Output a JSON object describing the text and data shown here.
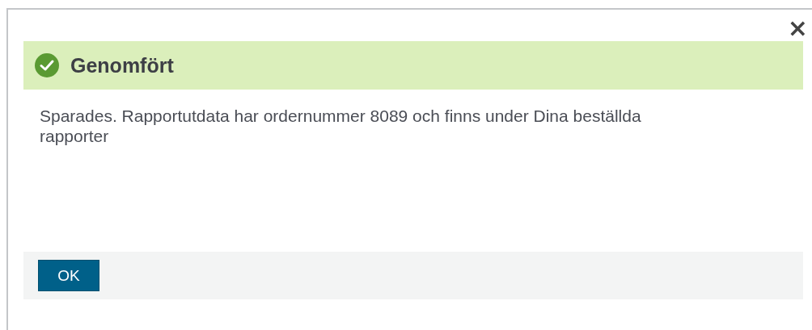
{
  "dialog": {
    "close": "×",
    "banner": {
      "kind": "success",
      "title": "Genomfört"
    },
    "message": "Sparades. Rapportutdata har ordernummer 8089 och finns under Dina beställda rapporter",
    "buttons": [
      "OK"
    ]
  }
}
